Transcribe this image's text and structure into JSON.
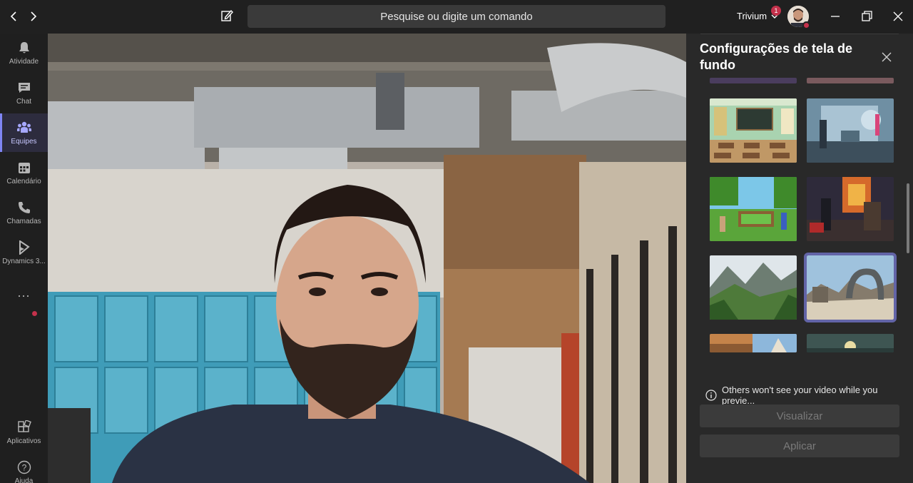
{
  "header": {
    "search_placeholder": "Pesquise ou digite um comando",
    "org_name": "Trivium",
    "notification_count": "1"
  },
  "rail": {
    "items": [
      {
        "label": "Atividade",
        "icon": "bell-icon"
      },
      {
        "label": "Chat",
        "icon": "chat-icon"
      },
      {
        "label": "Equipes",
        "icon": "teams-icon"
      },
      {
        "label": "Calendário",
        "icon": "calendar-icon"
      },
      {
        "label": "Chamadas",
        "icon": "phone-icon"
      },
      {
        "label": "Dynamics 3...",
        "icon": "dynamics-icon"
      },
      {
        "label": "Aplicativos",
        "icon": "apps-icon"
      },
      {
        "label": "Ajuda",
        "icon": "help-icon"
      }
    ],
    "more": "..."
  },
  "panel": {
    "title": "Configurações de tela de fundo",
    "notice": "Others won't see your video while you previe...",
    "preview_label": "Visualizar",
    "apply_label": "Aplicar"
  },
  "colors": {
    "accent": "#6264a7",
    "alert": "#c4314b",
    "rail_active": "#7f85f5"
  }
}
